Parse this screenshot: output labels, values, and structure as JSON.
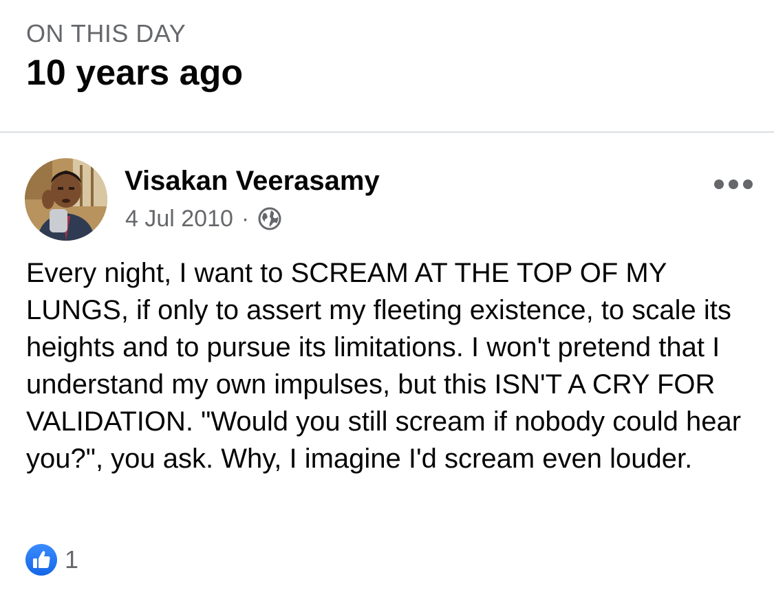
{
  "header": {
    "label": "ON THIS DAY",
    "title": "10 years ago"
  },
  "post": {
    "author": "Visakan Veerasamy",
    "date": "4 Jul 2010",
    "separator": "·",
    "privacy_icon": "globe-icon",
    "more_icon": "more-options-icon",
    "text": "Every night, I want to SCREAM AT THE TOP OF MY LUNGS, if only to assert my fleeting existence, to scale its heights and to pursue its limitations. I won't pretend that I understand my own impulses, but this ISN'T A CRY FOR VALIDATION. \"Would you still scream if nobody could hear you?\", you ask. Why, I imagine I'd scream even louder.",
    "reactions": {
      "icon": "like-icon",
      "count": "1"
    }
  },
  "colors": {
    "text_primary": "#050505",
    "text_secondary": "#65676b",
    "divider": "#dadde1",
    "like_blue": "#1877f2"
  }
}
